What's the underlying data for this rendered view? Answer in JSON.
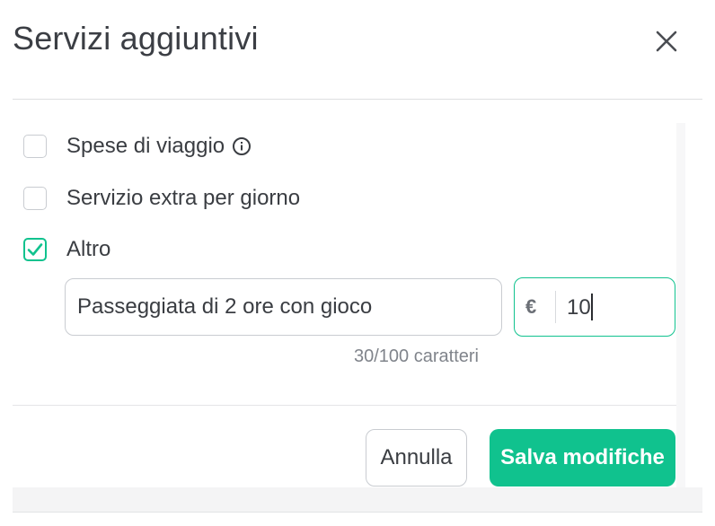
{
  "modal": {
    "title": "Servizi aggiuntivi",
    "close_icon": "close-icon"
  },
  "options": [
    {
      "label": "Spese di viaggio",
      "checked": false,
      "info_icon": "info-icon"
    },
    {
      "label": "Servizio extra per giorno",
      "checked": false
    },
    {
      "label": "Altro",
      "checked": true
    }
  ],
  "other": {
    "description_value": "Passeggiata di 2 ore con gioco",
    "char_counter": "30/100 caratteri",
    "currency_symbol": "€",
    "price_value": "10"
  },
  "footer": {
    "cancel_label": "Annulla",
    "save_label": "Salva modifiche"
  },
  "colors": {
    "accent": "#10c28e",
    "border": "#c9ccd1",
    "text": "#3a3d42"
  }
}
